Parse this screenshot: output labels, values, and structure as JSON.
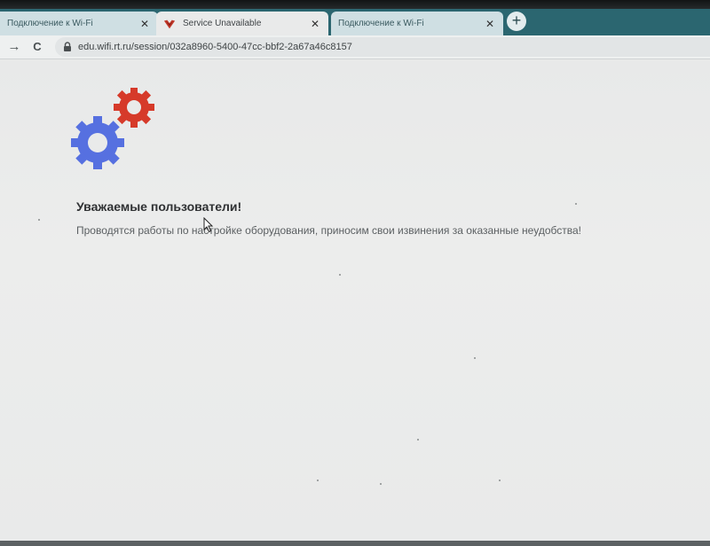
{
  "tabs": [
    {
      "title": "Подключение к Wi-Fi",
      "active": false
    },
    {
      "title": "Service Unavailable",
      "active": true
    },
    {
      "title": "Подключение к Wi-Fi",
      "active": false
    }
  ],
  "tab_close_glyph": "✕",
  "new_tab_glyph": "+",
  "toolbar": {
    "forward_glyph": "→",
    "reload_glyph": "C",
    "url": "edu.wifi.rt.ru/session/032a8960-5400-47cc-bbf2-2a67a46c8157"
  },
  "page": {
    "heading": "Уважаемые пользователи!",
    "message": "Проводятся работы по настройке оборудования, приносим свои извинения за оказанные неудобства!"
  },
  "colors": {
    "gear_small": "#d63a2a",
    "gear_large": "#5670e0",
    "tabstrip": "#2b6670"
  },
  "icons": [
    "favicon-icon",
    "lock-icon",
    "gear-icon",
    "cursor-icon"
  ]
}
